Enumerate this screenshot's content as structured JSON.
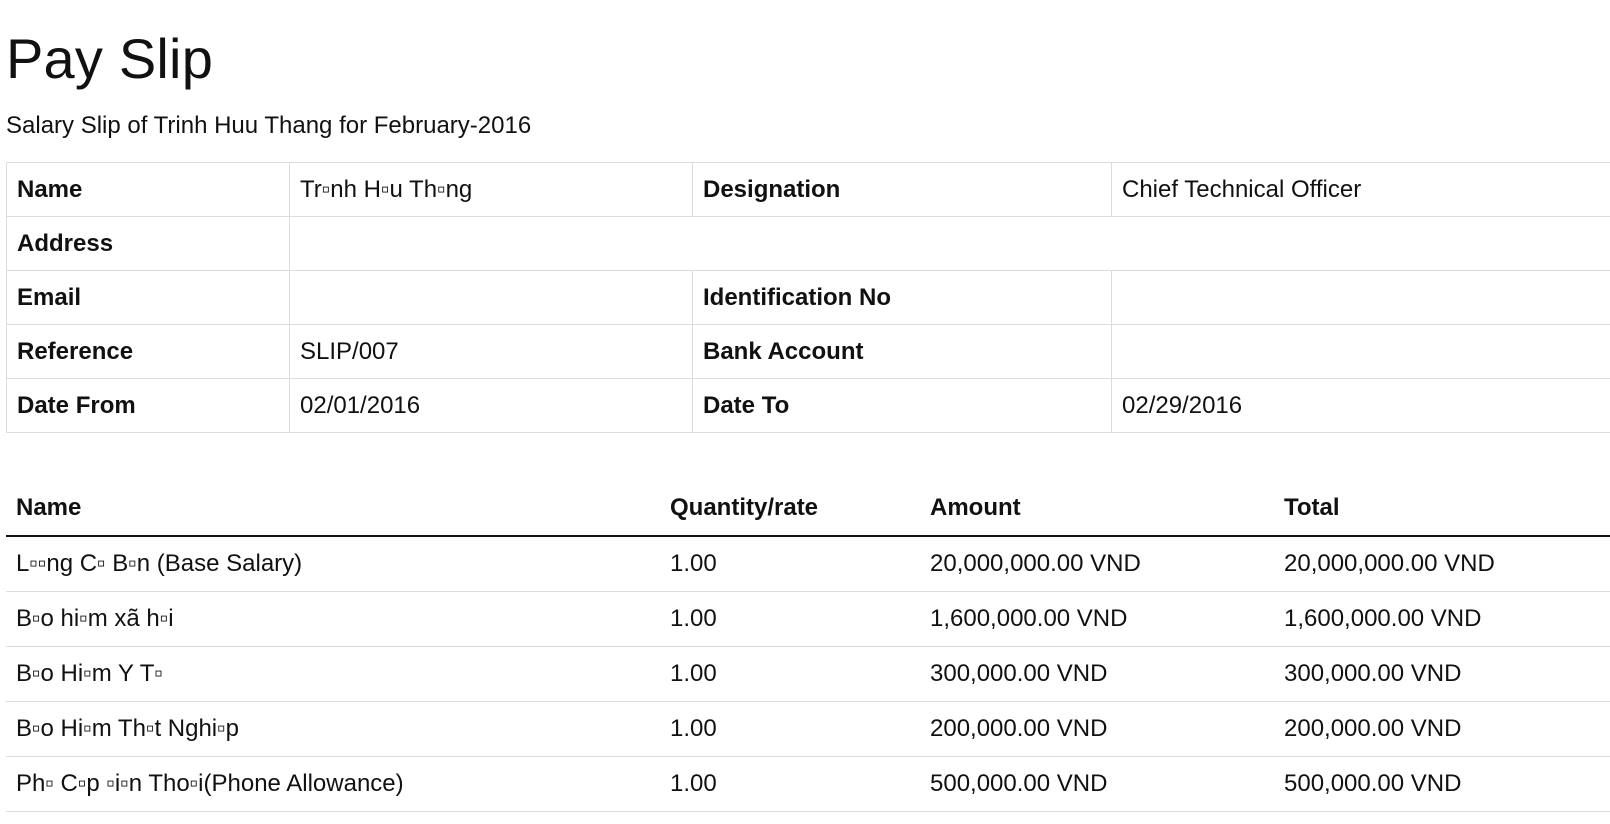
{
  "document": {
    "title": "Pay Slip",
    "subtitle": "Salary Slip of Trinh Huu Thang for February-2016"
  },
  "employee_info": {
    "name_label": "Name",
    "name_value": "Tr▫nh H▫u Th▫ng",
    "designation_label": "Designation",
    "designation_value": "Chief Technical Officer",
    "address_label": "Address",
    "address_value": "",
    "email_label": "Email",
    "email_value": "",
    "identification_label": "Identification No",
    "identification_value": "",
    "reference_label": "Reference",
    "reference_value": "SLIP/007",
    "bank_account_label": "Bank Account",
    "bank_account_value": "",
    "date_from_label": "Date From",
    "date_from_value": "02/01/2016",
    "date_to_label": "Date To",
    "date_to_value": "02/29/2016"
  },
  "lines_table": {
    "headers": [
      "Name",
      "Quantity/rate",
      "Amount",
      "Total"
    ],
    "rows": [
      [
        "L▫▫ng C▫ B▫n (Base Salary)",
        "1.00",
        "20,000,000.00 VND",
        "20,000,000.00 VND"
      ],
      [
        "B▫o hi▫m xã h▫i",
        "1.00",
        "1,600,000.00 VND",
        "1,600,000.00 VND"
      ],
      [
        "B▫o Hi▫m Y T▫",
        "1.00",
        "300,000.00 VND",
        "300,000.00 VND"
      ],
      [
        "B▫o Hi▫m Th▫t Nghi▫p",
        "1.00",
        "200,000.00 VND",
        "200,000.00 VND"
      ],
      [
        "Ph▫ C▫p ▫i▫n Tho▫i(Phone Allowance)",
        "1.00",
        "500,000.00 VND",
        "500,000.00 VND"
      ]
    ]
  }
}
